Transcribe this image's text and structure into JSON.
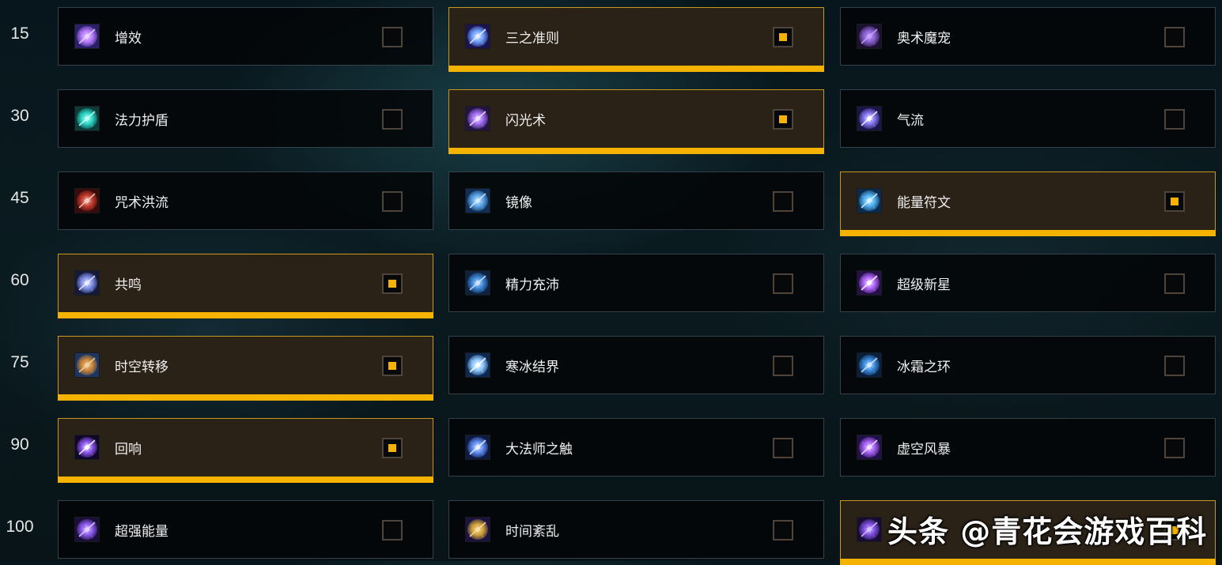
{
  "tiers": [
    {
      "level": "15",
      "talents": [
        {
          "name": "增效",
          "selected": false,
          "icon": "arcane-blast-icon"
        },
        {
          "name": "三之准则",
          "selected": true,
          "icon": "arcane-bolts-icon"
        },
        {
          "name": "奥术魔宠",
          "selected": false,
          "icon": "arcane-familiar-icon"
        }
      ]
    },
    {
      "level": "30",
      "talents": [
        {
          "name": "法力护盾",
          "selected": false,
          "icon": "mana-shield-icon"
        },
        {
          "name": "闪光术",
          "selected": true,
          "icon": "shimmer-icon"
        },
        {
          "name": "气流",
          "selected": false,
          "icon": "slipstream-icon"
        }
      ]
    },
    {
      "level": "45",
      "talents": [
        {
          "name": "咒术洪流",
          "selected": false,
          "icon": "incanters-flow-icon"
        },
        {
          "name": "镜像",
          "selected": false,
          "icon": "mirror-image-icon"
        },
        {
          "name": "能量符文",
          "selected": true,
          "icon": "rune-of-power-icon"
        }
      ]
    },
    {
      "level": "60",
      "talents": [
        {
          "name": "共鸣",
          "selected": true,
          "icon": "resonance-icon"
        },
        {
          "name": "精力充沛",
          "selected": false,
          "icon": "charged-up-icon"
        },
        {
          "name": "超级新星",
          "selected": false,
          "icon": "supernova-icon"
        }
      ]
    },
    {
      "level": "75",
      "talents": [
        {
          "name": "时空转移",
          "selected": true,
          "icon": "chrono-shift-icon"
        },
        {
          "name": "寒冰结界",
          "selected": false,
          "icon": "ice-ward-icon"
        },
        {
          "name": "冰霜之环",
          "selected": false,
          "icon": "ring-of-frost-icon"
        }
      ]
    },
    {
      "level": "90",
      "talents": [
        {
          "name": "回响",
          "selected": true,
          "icon": "reverberate-icon"
        },
        {
          "name": "大法师之触",
          "selected": false,
          "icon": "touch-of-archmage-icon"
        },
        {
          "name": "虚空风暴",
          "selected": false,
          "icon": "nether-tempest-icon"
        }
      ]
    },
    {
      "level": "100",
      "talents": [
        {
          "name": "超强能量",
          "selected": false,
          "icon": "overpowered-icon"
        },
        {
          "name": "时间紊乱",
          "selected": false,
          "icon": "time-anomaly-icon"
        },
        {
          "name": "",
          "selected": true,
          "icon": "arcane-orb-icon"
        }
      ]
    }
  ],
  "watermark": "头条 @青花会游戏百科",
  "colors": {
    "accent": "#f5b301",
    "selected_bg": "#2a2117",
    "selected_border": "#c8981e",
    "card_bg": "#030608",
    "card_border": "#35414a"
  }
}
